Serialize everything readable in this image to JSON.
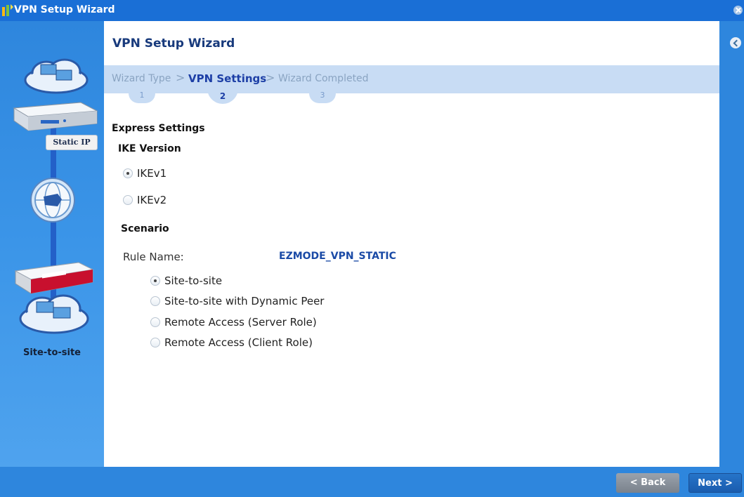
{
  "window": {
    "title": "VPN Setup Wizard"
  },
  "left_panel": {
    "static_ip_label": "Static IP",
    "scenario_label": "Site-to-site"
  },
  "main": {
    "title": "VPN Setup Wizard",
    "steps": [
      {
        "label": "Wizard Type",
        "number": "1",
        "state": "inactive"
      },
      {
        "label": "VPN Settings",
        "number": "2",
        "state": "active"
      },
      {
        "label": "Wizard Completed",
        "number": "3",
        "state": "inactive"
      }
    ],
    "step_separator": ">",
    "express_settings_heading": "Express Settings",
    "ike_version_heading": "IKE Version",
    "ike_options": [
      {
        "label": "IKEv1",
        "checked": true
      },
      {
        "label": "IKEv2",
        "checked": false
      }
    ],
    "scenario_heading": "Scenario",
    "rule_name_label": "Rule Name:",
    "rule_name_value": "EZMODE_VPN_STATIC",
    "scenario_options": [
      {
        "label": "Site-to-site",
        "checked": true
      },
      {
        "label": "Site-to-site with Dynamic Peer",
        "checked": false
      },
      {
        "label": "Remote Access (Server Role)",
        "checked": false
      },
      {
        "label": "Remote Access (Client Role)",
        "checked": false
      }
    ]
  },
  "footer": {
    "back_label": "< Back",
    "next_label": "Next >"
  },
  "icons": [
    "wizard-icon",
    "close-icon",
    "collapse-icon",
    "cloud-icon",
    "router-icon",
    "internet-globe-icon",
    "firewall-device-icon"
  ],
  "colors": {
    "title_bar": "#1a6fd6",
    "panel_blue": "#2e86dd",
    "steps_bar": "#c8dcf4",
    "active_step": "#1d3fa6",
    "rule_value": "#1a4aa6"
  }
}
